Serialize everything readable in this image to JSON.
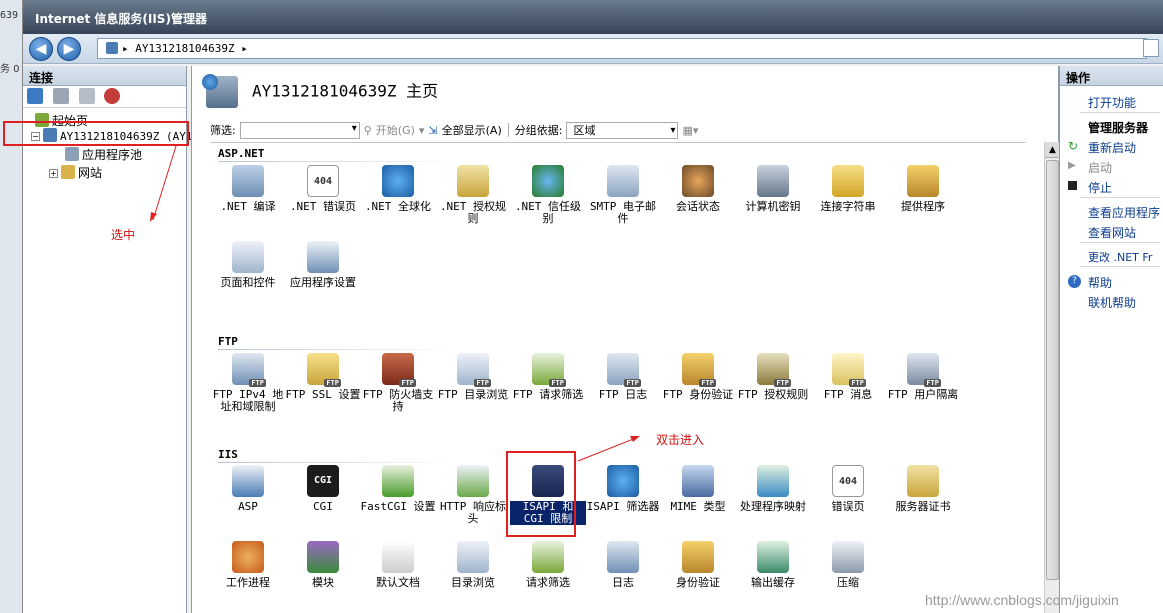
{
  "background_window": {
    "text_top": "639",
    "text_mid": "务 0"
  },
  "window": {
    "title": "Internet 信息服务(IIS)管理器"
  },
  "nav": {
    "back_icon": "back-arrow-icon",
    "forward_icon": "forward-arrow-icon",
    "address": "▸ AY1312181046​39Z ▸"
  },
  "connections": {
    "header": "连接",
    "tree": {
      "start_page": "起始页",
      "server": "AY131218104639Z (AY1",
      "app_pools": "应用程序池",
      "sites": "网站"
    },
    "annotation": "选中"
  },
  "home": {
    "title": "AY131218104639Z 主页",
    "filter_label": "筛选:",
    "start_label": "开始",
    "start_key": "(G)",
    "show_all": "全部显示(A)",
    "group_by_label": "分组依据:",
    "group_by_value": "区域",
    "sections": {
      "aspnet": "ASP.NET",
      "ftp": "FTP",
      "iis": "IIS"
    },
    "aspnet_features": [
      ".NET 编译",
      ".NET 错误页",
      ".NET 全球化",
      ".NET 授权规则",
      ".NET 信任级别",
      "SMTP 电子邮件",
      "会话状态",
      "计算机密钥",
      "连接字符串",
      "提供程序",
      "页面和控件",
      "应用程序设置"
    ],
    "ftp_features": [
      "FTP IPv4 地址和域限制",
      "FTP SSL 设置",
      "FTP 防火墙支持",
      "FTP 目录浏览",
      "FTP 请求筛选",
      "FTP 日志",
      "FTP 身份验证",
      "FTP 授权规则",
      "FTP 消息",
      "FTP 用户隔离"
    ],
    "iis_features": [
      "ASP",
      "CGI",
      "FastCGI 设置",
      "HTTP 响应标头",
      "ISAPI 和 CGI 限制",
      "ISAPI 筛选器",
      "MIME 类型",
      "处理程序映射",
      "错误页",
      "服务器证书",
      "工作进程",
      "模块",
      "默认文档",
      "目录浏览",
      "请求筛选",
      "日志",
      "身份验证",
      "输出缓存",
      "压缩"
    ],
    "icon_texts": {
      "err404": "404",
      "cgi": "CGI",
      "ftp_tag": "FTP"
    },
    "annotation": "双击进入"
  },
  "actions": {
    "header": "操作",
    "open_feature": "打开功能",
    "manage_server": "管理服务器",
    "restart": "重新启动",
    "start": "启动",
    "stop": "停止",
    "view_apps": "查看应用程序",
    "view_sites": "查看网站",
    "change_net": "更改 .NET Fr",
    "help": "帮助",
    "online_help": "联机帮助"
  },
  "watermark": "http://www.cnblogs.com/jiguixin",
  "colors": {
    "selection": "#0a246a",
    "annotation": "#d01010",
    "link": "#0b3c8c"
  }
}
